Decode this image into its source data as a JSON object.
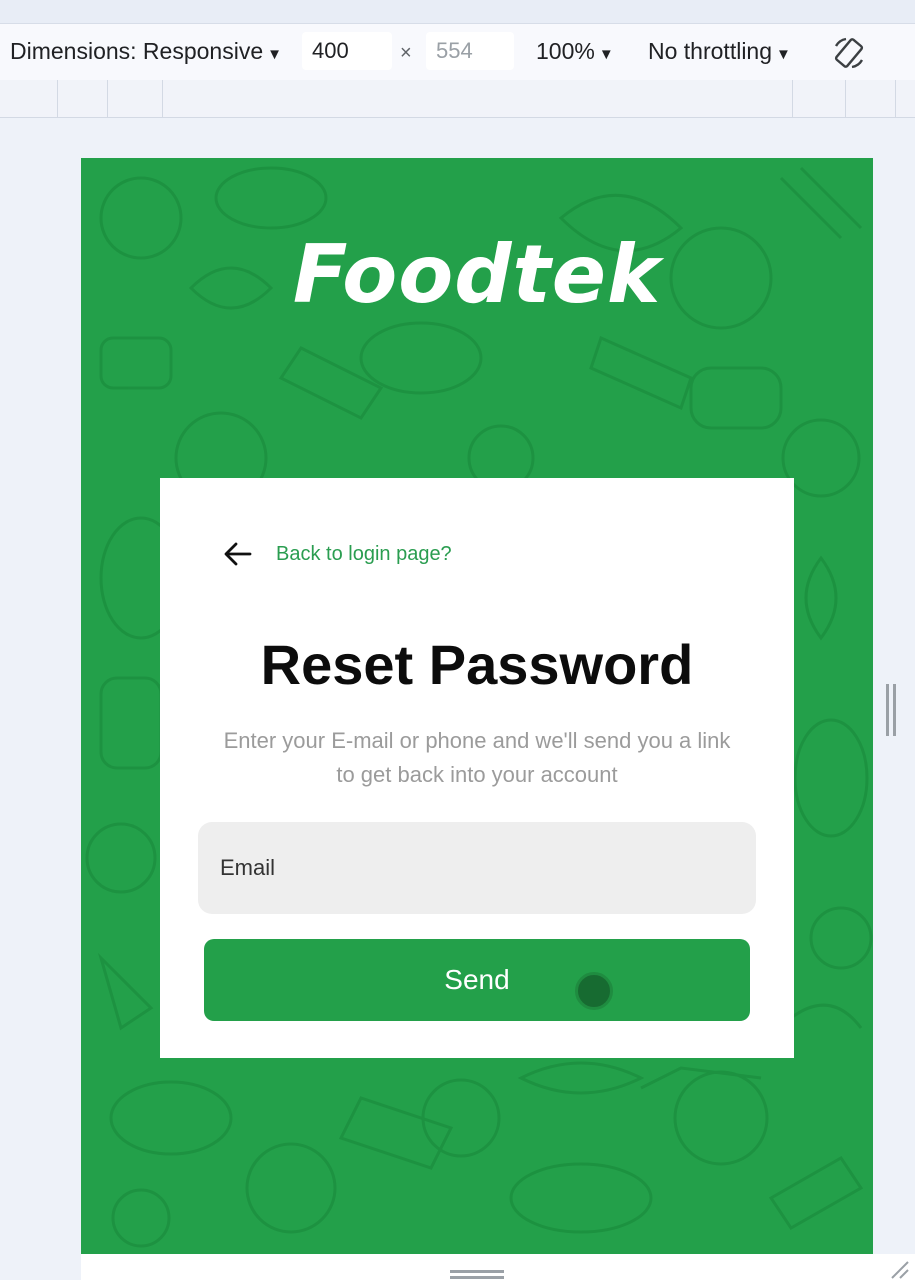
{
  "devtools": {
    "dimensions_label": "Dimensions: Responsive",
    "width_value": "400",
    "times": "×",
    "height_value": "554",
    "zoom_label": "100%",
    "throttle_label": "No throttling",
    "caret": "▼",
    "rotate_icon": "rotate-icon"
  },
  "app": {
    "logo": "Foodtek",
    "background_color": "#23a04a",
    "accent_color": "#2a9d50"
  },
  "card": {
    "back_link": "Back to login page?",
    "title": "Reset Password",
    "subtitle": "Enter your E-mail or phone and we'll send you a link to get back into your account",
    "email_placeholder": "Email",
    "send_label": "Send"
  }
}
